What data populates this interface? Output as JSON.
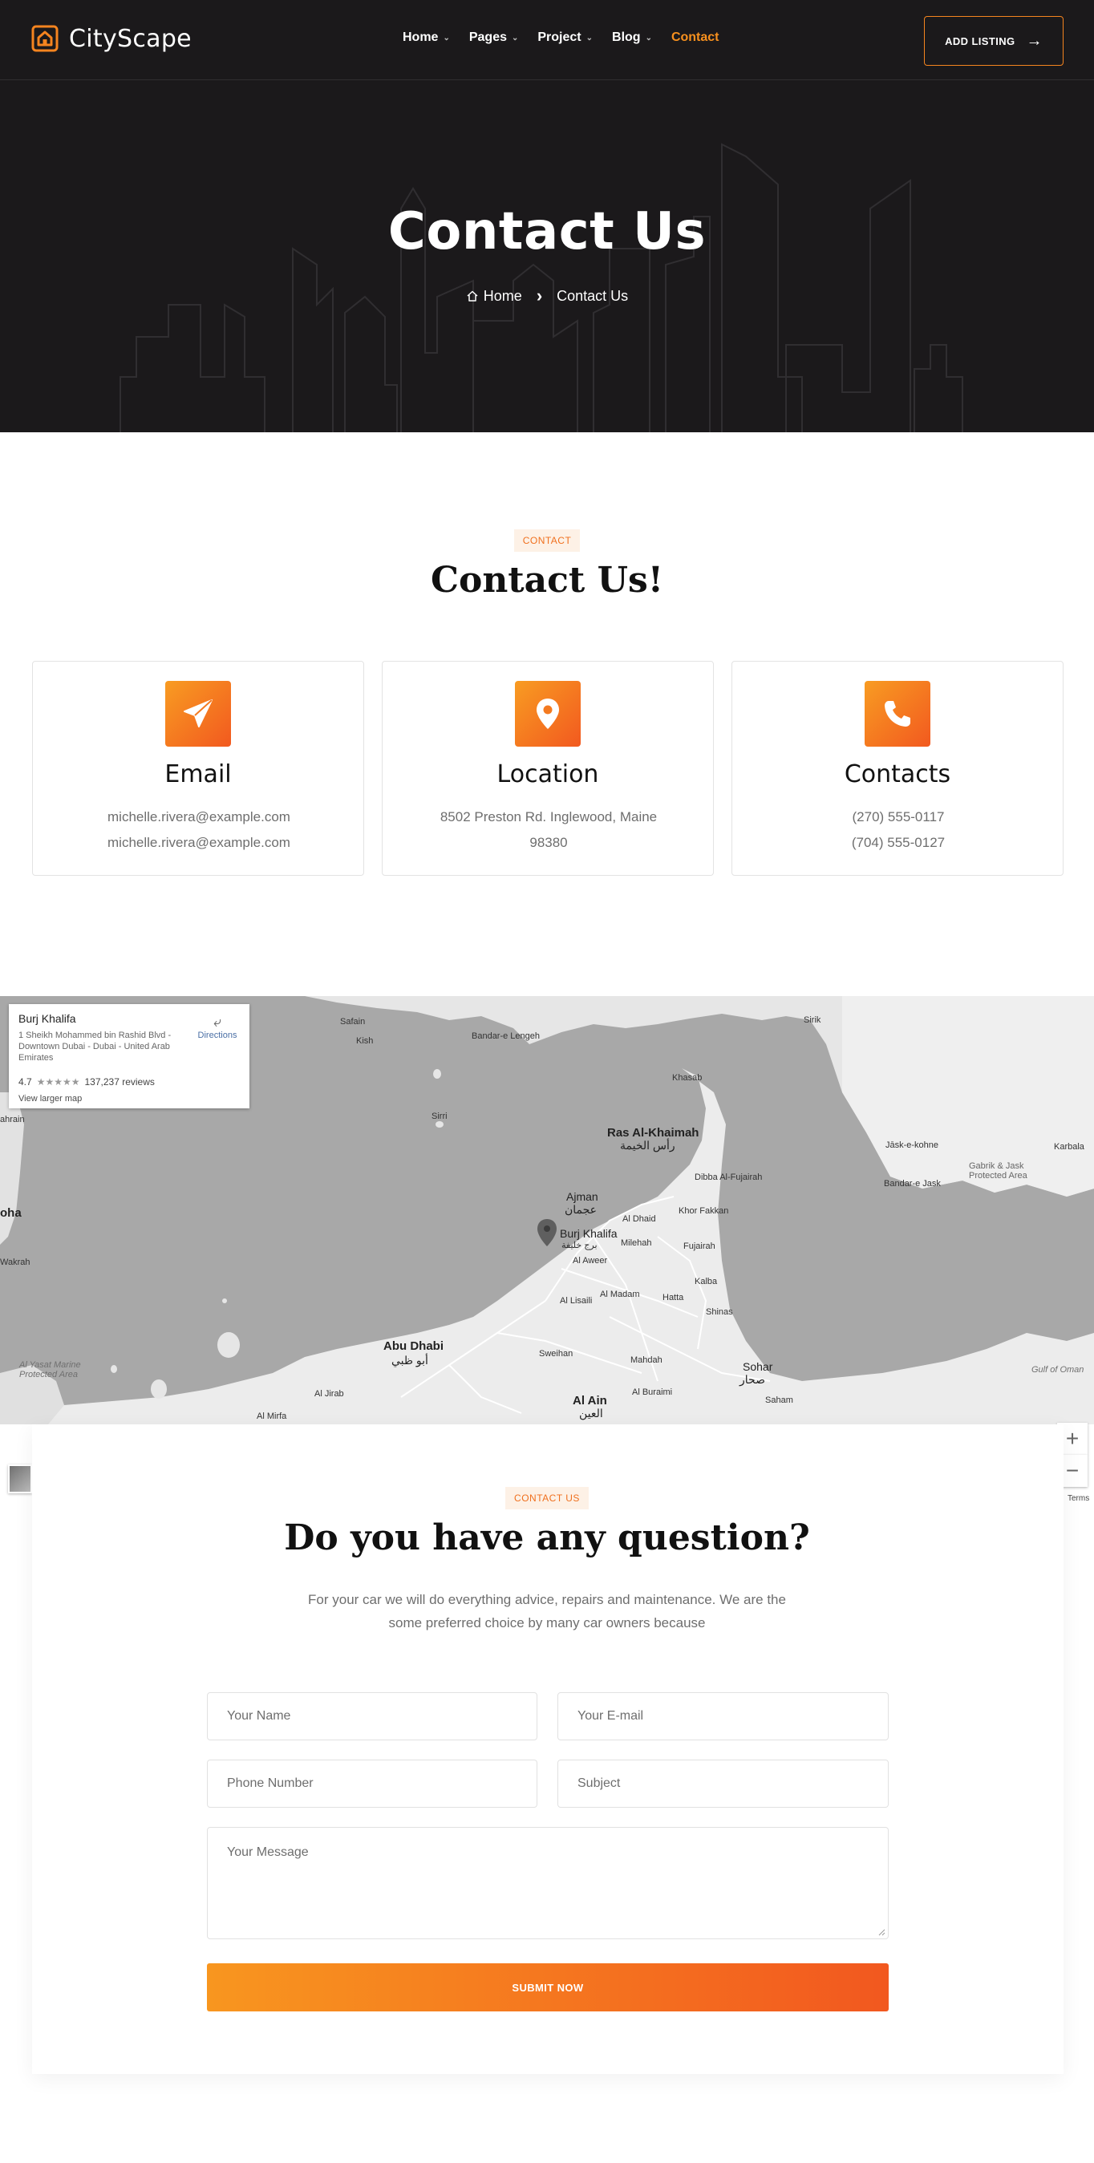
{
  "header": {
    "brand": "CityScape",
    "nav": [
      {
        "label": "Home",
        "has_dropdown": true
      },
      {
        "label": "Pages",
        "has_dropdown": true
      },
      {
        "label": "Project",
        "has_dropdown": true
      },
      {
        "label": "Blog",
        "has_dropdown": true
      },
      {
        "label": "Contact",
        "has_dropdown": false,
        "active": true
      }
    ],
    "cta": "ADD LISTING"
  },
  "hero": {
    "title": "Contact Us",
    "breadcrumb": {
      "home": "Home",
      "current": "Contact Us"
    }
  },
  "contact_section": {
    "tag": "CONTACT",
    "title": "Contact Us!",
    "cards": [
      {
        "icon": "paper-plane-icon",
        "title": "Email",
        "lines": [
          "michelle.rivera@example.com",
          "michelle.rivera@example.com"
        ]
      },
      {
        "icon": "location-pin-icon",
        "title": "Location",
        "lines": [
          "8502 Preston Rd. Inglewood, Maine",
          "98380"
        ]
      },
      {
        "icon": "phone-icon",
        "title": "Contacts",
        "lines": [
          "(270) 555-0117",
          "(704) 555-0127"
        ]
      }
    ]
  },
  "map": {
    "place_card": {
      "title": "Burj Khalifa",
      "address": "1 Sheikh Mohammed bin Rashid Blvd - Downtown Dubai - Dubai - United Arab Emirates",
      "rating": "4.7",
      "stars": "★★★★★",
      "reviews": "137,237 reviews",
      "larger_map": "View larger map",
      "directions": "Directions"
    },
    "labels": {
      "ras_al_khaimah": "Ras Al-Khaimah",
      "ras_al_khaimah_ar": "رأس الخيمة",
      "ajman": "Ajman",
      "ajman_ar": "عجمان",
      "burj": "Burj Khalifa",
      "burj_ar": "برج خليفة",
      "abu_dhabi": "Abu Dhabi",
      "abu_dhabi_ar": "أبو ظبي",
      "al_ain": "Al Ain",
      "al_ain_ar": "العين",
      "sohar": "Sohar",
      "sohar_ar": "صحار",
      "khasab": "Khasab",
      "dibba": "Dibba Al-Fujairah",
      "khor_fakkan": "Khor Fakkan",
      "fujairah": "Fujairah",
      "al_dhaid": "Al Dhaid",
      "milehah": "Milehah",
      "al_aweer": "Al Aweer",
      "al_madam": "Al Madam",
      "hatta": "Hatta",
      "kalba": "Kalba",
      "shinas": "Shinas",
      "al_lisaili": "Al Lisaili",
      "sweihan": "Sweihan",
      "mahdah": "Mahdah",
      "al_buraimi": "Al Buraimi",
      "saham": "Saham",
      "sirri": "Sirri",
      "safain": "Safain",
      "kish": "Kish",
      "bandar_lengeh": "Bandar-e Lengeh",
      "sirik": "Sirik",
      "jask": "Jāsk-e-kohne",
      "bandar_jask": "Bandar-e Jask",
      "gabrik": "Gabrik & Jask Protected Area",
      "karbala": "Karbala",
      "al_yasat": "Al Yasat Marine Protected Area",
      "al_jirab": "Al Jirab",
      "al_mirfa": "Al Mirfa",
      "gulf_of_oman": "Gulf of Oman",
      "doha": "oha",
      "wakrah": "Wakrah",
      "ahrain": "ahrain"
    },
    "zoom_in": "+",
    "zoom_out": "−",
    "terms": "Terms"
  },
  "form_section": {
    "tag": "CONTACT US",
    "title": "Do you have any question?",
    "description_lines": [
      "For your car we will do everything advice, repairs and maintenance. We are the",
      "some preferred choice by many car owners because"
    ],
    "fields": {
      "name": "Your Name",
      "email": "Your E-mail",
      "phone": "Phone Number",
      "subject": "Subject",
      "message": "Your Message"
    },
    "submit": "SUBMIT NOW"
  },
  "colors": {
    "accent": "#f7901e",
    "accent_dark": "#f2581f",
    "hero_bg": "#1b191b",
    "tag_bg": "#fdf1e6",
    "map_land": "#a8a8a8",
    "map_water": "#dedede"
  }
}
